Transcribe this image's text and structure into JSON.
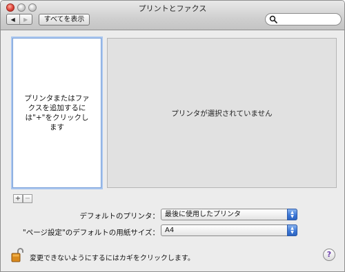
{
  "window": {
    "title": "プリントとファクス"
  },
  "toolbar": {
    "back_glyph": "◀",
    "forward_glyph": "▶",
    "show_all_label": "すべてを表示",
    "search_value": "",
    "search_icon": "magnifier-icon"
  },
  "printer_list": {
    "hint": "プリンタまたはファクスを追加するには\"+\"をクリックします",
    "add_label": "+",
    "remove_label": "−"
  },
  "detail": {
    "message": "プリンタが選択されていません"
  },
  "settings": {
    "default_printer_label": "デフォルトのプリンタ：",
    "default_printer_value": "最後に使用したプリンタ",
    "paper_size_label": "\"ページ設定\"のデフォルトの用紙サイズ：",
    "paper_size_value": "A4"
  },
  "footer": {
    "lock_text": "変更できないようにするにはカギをクリックします。",
    "help_label": "?"
  },
  "colors": {
    "accent": "#3c78d8",
    "selection_ring": "#a9c6ef",
    "close_button": "#e0443a"
  }
}
